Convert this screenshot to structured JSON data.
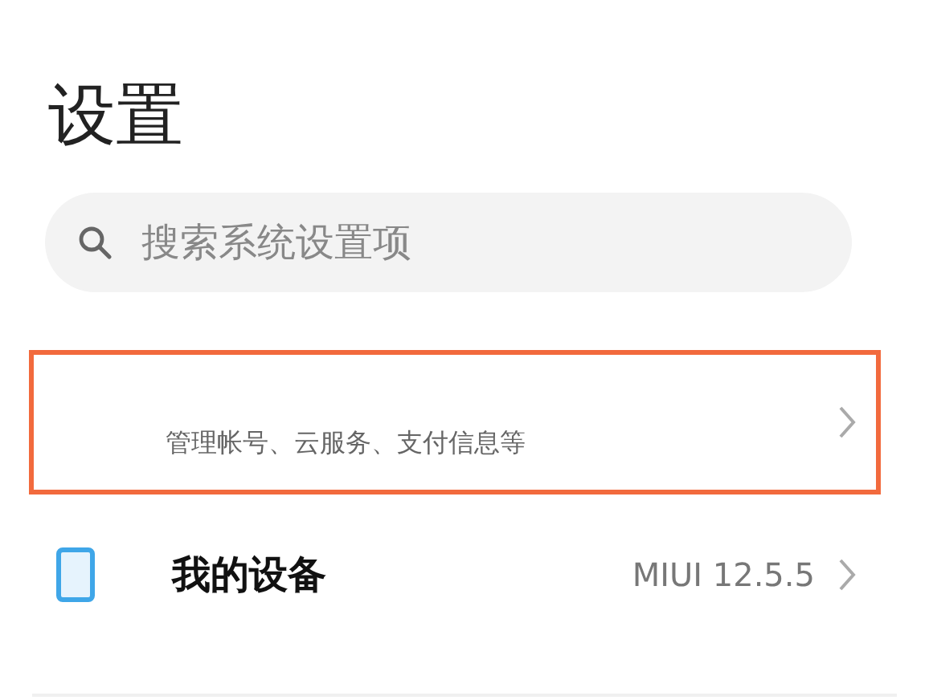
{
  "title": "设置",
  "search": {
    "placeholder": "搜索系统设置项"
  },
  "rows": [
    {
      "kind": "account",
      "subtitle": "管理帐号、云服务、支付信息等",
      "highlighted": true
    },
    {
      "kind": "device",
      "label": "我的设备",
      "value": "MIUI 12.5.5",
      "highlighted": false
    }
  ]
}
